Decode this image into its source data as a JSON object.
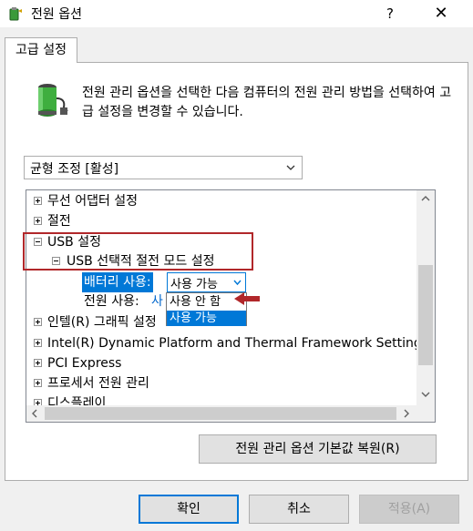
{
  "window": {
    "title": "전원 옵션",
    "help_label": "?",
    "close_label": "✕"
  },
  "tab": {
    "label": "고급 설정"
  },
  "description": "전원 관리 옵션을 선택한 다음 컴퓨터의 전원 관리 방법을 선택하여 고급 설정을 변경할 수 있습니다.",
  "plan_select": {
    "value": "균형 조정 [활성]"
  },
  "tree": {
    "items": [
      {
        "label": "무선 어댑터 설정",
        "expander": "plus"
      },
      {
        "label": "절전",
        "expander": "plus"
      },
      {
        "label": "USB 설정",
        "expander": "minus"
      },
      {
        "label": "USB 선택적 절전 모드 설정",
        "expander": "minus"
      },
      {
        "label": "배터리 사용:"
      },
      {
        "label": "전원 사용:",
        "value": "사"
      },
      {
        "label": "인텔(R) 그래픽 설정",
        "expander": "plus"
      },
      {
        "label": "Intel(R) Dynamic Platform and Thermal Framework Settings",
        "expander": "plus"
      },
      {
        "label": "PCI Express",
        "expander": "plus"
      },
      {
        "label": "프로세서 전원 관리",
        "expander": "plus"
      },
      {
        "label": "디스플레이",
        "expander": "plus"
      }
    ],
    "battery_select_value": "사용 가능",
    "dropdown_options": [
      "사용 안 함",
      "사용 가능"
    ]
  },
  "buttons": {
    "restore": "전원 관리 옵션 기본값 복원(R)",
    "ok": "확인",
    "cancel": "취소",
    "apply": "적용(A)"
  },
  "colors": {
    "accent": "#0078d7",
    "highlight_box": "#b1272a",
    "arrow": "#b1272a",
    "link_value": "#0066cc"
  },
  "icons": {
    "app": "power-options-icon",
    "battery": "battery-plug-icon"
  }
}
